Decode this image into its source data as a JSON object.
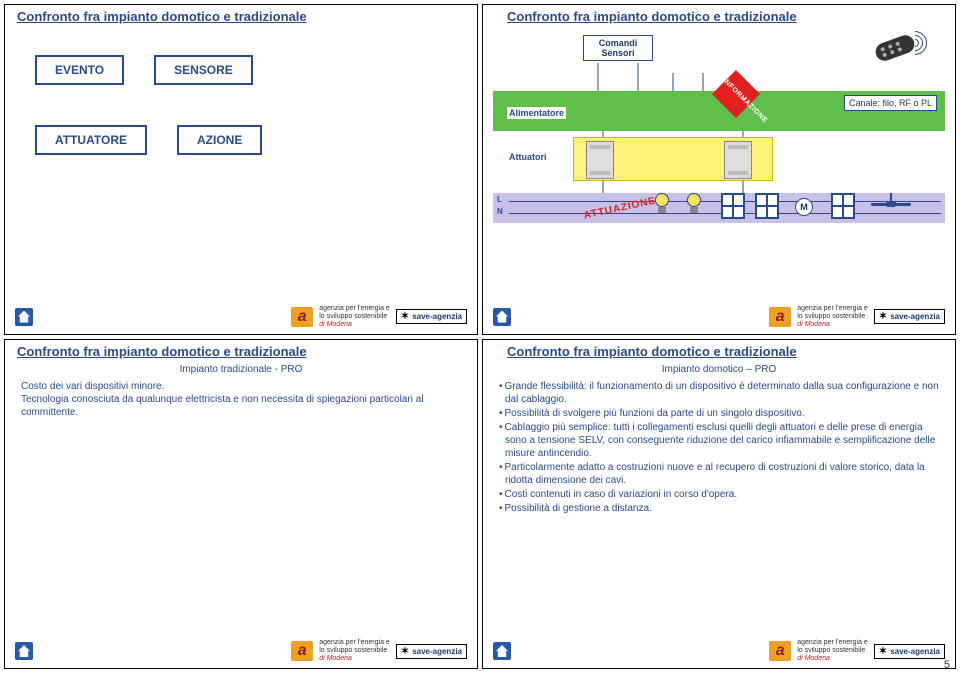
{
  "footer": {
    "agency_line1": "agenzia per l'energia e",
    "agency_line2": "lo sviluppo sostenibile",
    "agency_line3": "di Modena",
    "save": "save",
    "save_sub": "-agenzia"
  },
  "page_number": "5",
  "slide1": {
    "title": "Confronto fra impianto domotico e tradizionale",
    "box_evento": "EVENTO",
    "box_sensore": "SENSORE",
    "box_attuatore": "ATTUATORE",
    "box_azione": "AZIONE"
  },
  "slide2": {
    "title": "Confronto fra impianto domotico e tradizionale",
    "comandi": "Comandi",
    "sensori": "Sensori",
    "alimentatore": "Alimentatore",
    "attuatori": "Attuatori",
    "info_tag": "INFORMAZIONE",
    "canale": "Canale: filo, RF o PL",
    "attuazione": "ATTUAZIONE",
    "L": "L",
    "N": "N",
    "M": "M"
  },
  "slide3": {
    "title": "Confronto fra impianto domotico e tradizionale",
    "subtitle": "Impianto tradizionale - PRO",
    "line1": "Costo dei vari dispositivi minore.",
    "line2": "Tecnologia conosciuta da qualunque elettricista e non necessita di spiegazioni particolari al committente."
  },
  "slide4": {
    "title": "Confronto fra impianto domotico e tradizionale",
    "subtitle": "Impianto domotico – PRO",
    "bullets": [
      "Grande flessibilità: il funzionamento di un dispositivo è determinato dalla sua configurazione e non dal cablaggio.",
      "Possibilità di svolgere più funzioni da parte di un singolo dispositivo.",
      "Cablaggio più semplice: tutti i collegamenti esclusi quelli degli attuatori e delle prese di energia sono a tensione SELV, con conseguente riduzione del carico infiammabile e semplificazione delle misure antincendio.",
      "Particolarmente adatto a costruzioni nuove e al recupero di costruzioni di valore storico, data la ridotta dimensione dei cavi.",
      "Costi contenuti in caso di variazioni in corso d'opera.",
      "Possibilità di gestione a distanza."
    ]
  }
}
